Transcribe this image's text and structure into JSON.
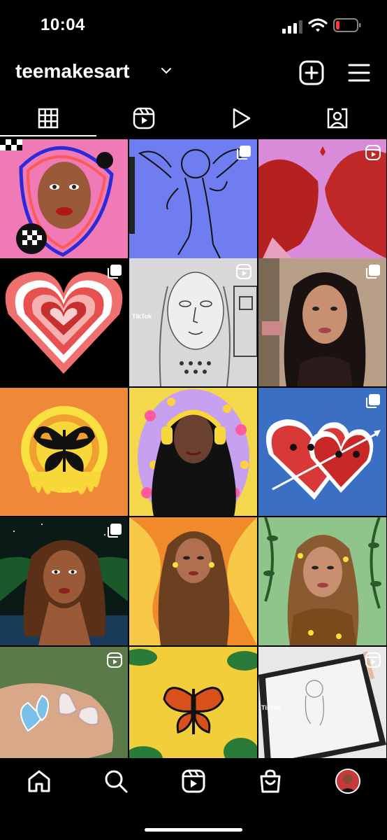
{
  "status_bar": {
    "time": "10:04",
    "battery_color": "#ff3b30"
  },
  "profile": {
    "username": "teemakesart"
  },
  "header_icons": [
    "chevron-down-icon",
    "new-post-icon",
    "menu-icon"
  ],
  "tabs": [
    {
      "icon": "grid-icon",
      "active": true
    },
    {
      "icon": "reels-icon",
      "active": false
    },
    {
      "icon": "video-play-icon",
      "active": false
    },
    {
      "icon": "tagged-icon",
      "active": false
    }
  ],
  "posts": [
    {
      "subject": "woman portrait with checkered shapes",
      "badge": "",
      "bg": "#f07ab6"
    },
    {
      "subject": "cherub line drawing",
      "badge": "carousel",
      "bg": "#6f7df0"
    },
    {
      "subject": "kissing couple",
      "badge": "reel",
      "bg": "#d98ad9"
    },
    {
      "subject": "layered heart",
      "badge": "carousel",
      "bg": "#000000"
    },
    {
      "subject": "pencil sketch portrait",
      "badge": "reel",
      "bg": "#d8d8d8",
      "overlay_text": "TikTok"
    },
    {
      "subject": "selfie photo",
      "badge": "carousel",
      "bg": "#8a7060"
    },
    {
      "subject": "butterfly in sun",
      "badge": "",
      "bg": "#f0883a"
    },
    {
      "subject": "girl with headphones",
      "badge": "",
      "bg": "#f2d84a"
    },
    {
      "subject": "two hearts with arrow",
      "badge": "carousel",
      "bg": "#3a6fc4"
    },
    {
      "subject": "woman portrait night",
      "badge": "carousel",
      "bg": "#0a1a14"
    },
    {
      "subject": "woman long hair orange",
      "badge": "",
      "bg": "#f08a2a"
    },
    {
      "subject": "woman with vines",
      "badge": "",
      "bg": "#8fc48a"
    },
    {
      "subject": "butterfly earrings in hand",
      "badge": "reel",
      "bg": "#5a7a4a"
    },
    {
      "subject": "monarch butterfly leaves",
      "badge": "",
      "bg": "#f2cf3a"
    },
    {
      "subject": "tablet drawing",
      "badge": "reel",
      "bg": "#e8e8e8",
      "overlay_text": "TikTok"
    }
  ],
  "bottom_nav": [
    "home-icon",
    "search-icon",
    "reels-icon",
    "shop-icon",
    "profile-avatar"
  ]
}
